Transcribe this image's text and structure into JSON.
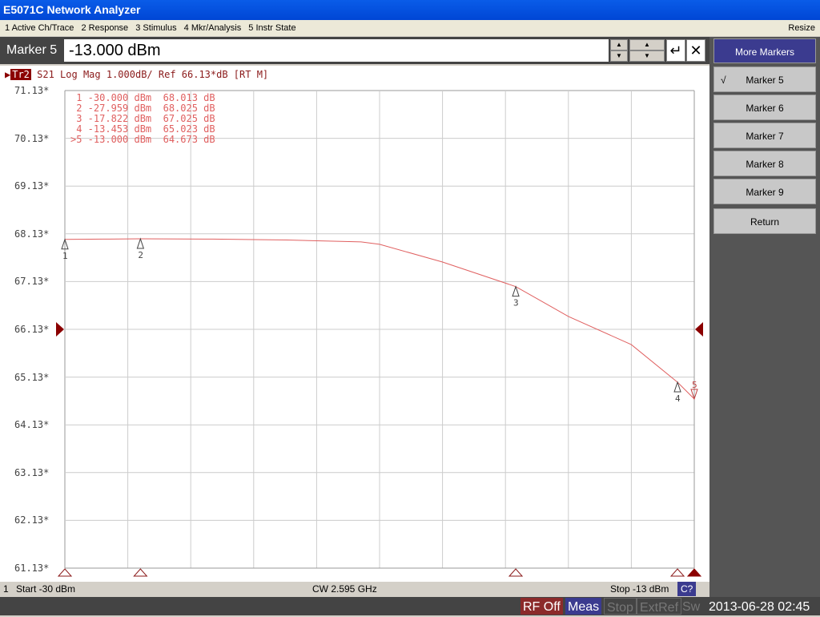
{
  "window": {
    "title": "E5071C Network Analyzer",
    "resize": "Resize"
  },
  "menu": [
    "1 Active Ch/Trace",
    "2 Response",
    "3 Stimulus",
    "4 Mkr/Analysis",
    "5 Instr State"
  ],
  "entry": {
    "label": "Marker 5",
    "value": "-13.000 dBm",
    "up": "▲",
    "down": "▼",
    "enter": "↵",
    "close": "✕"
  },
  "trace": {
    "id": "Tr2",
    "desc": "S21 Log Mag 1.000dB/ Ref 66.13*dB [RT M]",
    "color": "#e06060"
  },
  "y_ticks": [
    "71.13*",
    "70.13*",
    "69.13*",
    "68.13*",
    "67.13*",
    "66.13*",
    "65.13*",
    "64.13*",
    "63.13*",
    "62.13*",
    "61.13*"
  ],
  "marker_table": [
    " 1 -30.000 dBm  68.013 dB",
    " 2 -27.959 dBm  68.025 dB",
    " 3 -17.822 dBm  67.025 dB",
    " 4 -13.453 dBm  65.023 dB",
    ">5 -13.000 dBm  64.673 dB"
  ],
  "chart_data": {
    "type": "line",
    "xlim": [
      -30,
      -13
    ],
    "ylim": [
      61.13,
      71.13
    ],
    "grid": true,
    "x": [
      -30,
      -28.8,
      -27.959,
      -26,
      -24,
      -22,
      -21.5,
      -19.8,
      -17.822,
      -16.4,
      -14.7,
      -13.453,
      -13
    ],
    "y": [
      68.013,
      68.02,
      68.025,
      68.02,
      68.0,
      67.96,
      67.91,
      67.54,
      67.025,
      66.4,
      65.81,
      65.023,
      64.673
    ],
    "markers": [
      {
        "n": "1",
        "x": -30,
        "y": 68.013
      },
      {
        "n": "2",
        "x": -27.959,
        "y": 68.025
      },
      {
        "n": "3",
        "x": -17.822,
        "y": 67.025
      },
      {
        "n": "4",
        "x": -13.453,
        "y": 65.023
      },
      {
        "n": "5",
        "x": -13,
        "y": 64.673
      }
    ],
    "ref_level": 66.13
  },
  "footer": {
    "ch": "1",
    "start": "Start -30 dBm",
    "cw": "CW 2.595 GHz",
    "stop": "Stop -13 dBm",
    "cal": "C?"
  },
  "status": {
    "rf": "RF Off",
    "meas": "Meas",
    "stop": "Stop",
    "extref": "ExtRef",
    "sw": "Sw",
    "time": "2013-06-28 02:45"
  },
  "side": {
    "head": "More Markers",
    "items": [
      {
        "label": "Marker 5",
        "check": "√"
      },
      {
        "label": "Marker 6"
      },
      {
        "label": "Marker 7"
      },
      {
        "label": "Marker 8"
      },
      {
        "label": "Marker 9"
      },
      {
        "label": "Return"
      }
    ]
  }
}
